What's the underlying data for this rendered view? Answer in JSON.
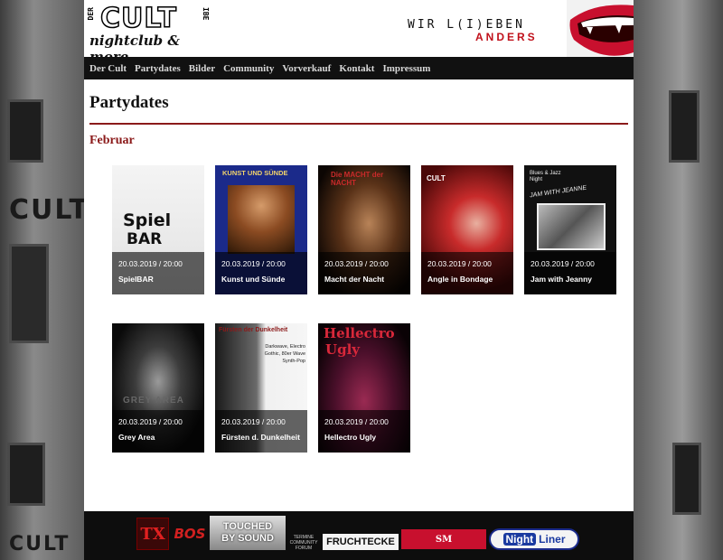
{
  "header": {
    "logo_main": "CULT",
    "logo_der": "DER",
    "logo_ibe": "IBE",
    "logo_sub": "nightclub & more",
    "slogan_top": "WIR L(I)EBEN",
    "slogan_bottom": "ANDERS"
  },
  "nav": {
    "items": [
      {
        "label": "Der Cult"
      },
      {
        "label": "Partydates"
      },
      {
        "label": "Bilder"
      },
      {
        "label": "Community"
      },
      {
        "label": "Vorverkauf"
      },
      {
        "label": "Kontakt"
      },
      {
        "label": "Impressum"
      }
    ]
  },
  "page": {
    "title": "Partydates",
    "month": "Februar"
  },
  "events": [
    {
      "date": "20.03.2019 / 20:00",
      "name": "SpielBAR",
      "poster_text_1": "Spiel",
      "poster_text_2": "BAR"
    },
    {
      "date": "20.03.2019 / 20:00",
      "name": "Kunst und Sünde",
      "poster_text_1": "KUNST UND SÜNDE"
    },
    {
      "date": "20.03.2019 / 20:00",
      "name": "Macht der Nacht",
      "poster_text_1": "Die MACHT der NACHT"
    },
    {
      "date": "20.03.2019 / 20:00",
      "name": "Angle in Bondage",
      "poster_text_1": "CULT"
    },
    {
      "date": "20.03.2019 / 20:00",
      "name": "Jam with Jeanny",
      "poster_text_1": "Blues & Jazz Night",
      "poster_text_2": "JAM WITH JEANNE"
    },
    {
      "date": "20.03.2019 / 20:00",
      "name": "Grey Area",
      "poster_text_1": "GREY AREA"
    },
    {
      "date": "20.03.2019 / 20:00",
      "name": "Fürsten d. Dunkelheit",
      "poster_text_1": "Fürsten der Dunkelheit",
      "poster_text_2": "Darkwave, Electro Gothic, 80er Wave Synth-Pop"
    },
    {
      "date": "20.03.2019 / 20:00",
      "name": "Hellectro Ugly",
      "poster_text_1": "Hellectro",
      "poster_text_2": "Ugly"
    }
  ],
  "footer": {
    "sponsors": [
      {
        "label": "TX",
        "icon": "tx-logo"
      },
      {
        "label": "BOS",
        "icon": "bos-logo"
      },
      {
        "label": "TOUCHED BY SOUND",
        "icon": "touched-by-sound-logo"
      },
      {
        "label": "TERMINE COMMUNITY FORUM",
        "icon": "community-forum-logo"
      },
      {
        "label": "FRUCHTECKE",
        "icon": "fruchtecke-logo"
      },
      {
        "label": "SM",
        "icon": "sm-logo"
      },
      {
        "label": "Night",
        "label2": "Liner",
        "icon": "nightliner-logo"
      }
    ]
  },
  "colors": {
    "accent": "#8b1a1a",
    "nav_bg": "#111111",
    "slogan_red": "#c0101a"
  }
}
